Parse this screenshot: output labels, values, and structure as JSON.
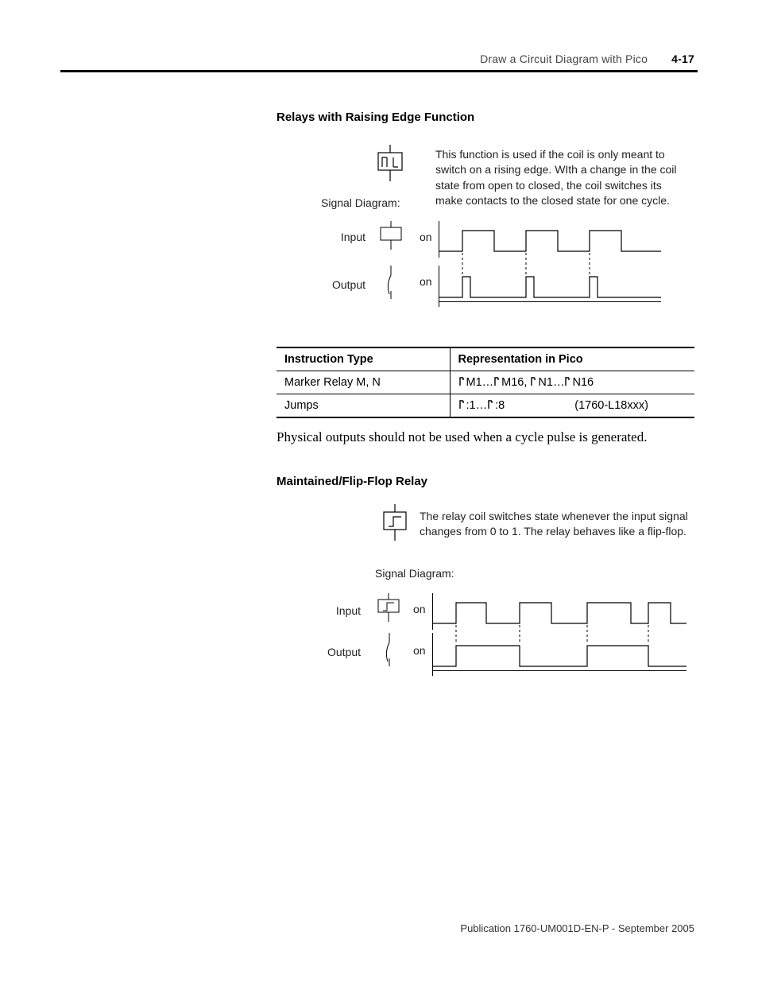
{
  "header": {
    "running": "Draw a Circuit Diagram with Pico",
    "page": "4-17"
  },
  "sections": {
    "rising": {
      "heading": "Relays with Raising Edge Function",
      "desc": "This function is used if the coil is only meant to switch on a rising edge. WIth a change in the coil state from open to closed, the coil switches its make contacts to the closed state for one cycle.",
      "signal_label": "Signal Diagram:",
      "input_label": "Input",
      "output_label": "Output",
      "on": "on"
    },
    "flipflop": {
      "heading": "Maintained/Flip-Flop Relay",
      "desc": "The relay coil switches state whenever the input signal changes from 0 to 1. The relay behaves like a flip-flop.",
      "signal_label": "Signal Diagram:",
      "input_label": "Input",
      "output_label": "Output",
      "on": "on"
    }
  },
  "body_note": "Physical outputs should not be used when a cycle pulse is generated.",
  "table": {
    "headers": [
      "Instruction Type",
      "Representation in Pico"
    ],
    "rows": [
      {
        "type": "Marker Relay M, N",
        "rep_a": "M1…",
        "rep_b": "M16, ",
        "rep_c": "N1…",
        "rep_d": "N16",
        "extra": ""
      },
      {
        "type": "Jumps",
        "rep_a": ":1…",
        "rep_b": ":8",
        "rep_c": "",
        "rep_d": "",
        "extra": "(1760-L18xxx)"
      }
    ]
  },
  "footer": "Publication 1760-UM001D-EN-P - September 2005"
}
